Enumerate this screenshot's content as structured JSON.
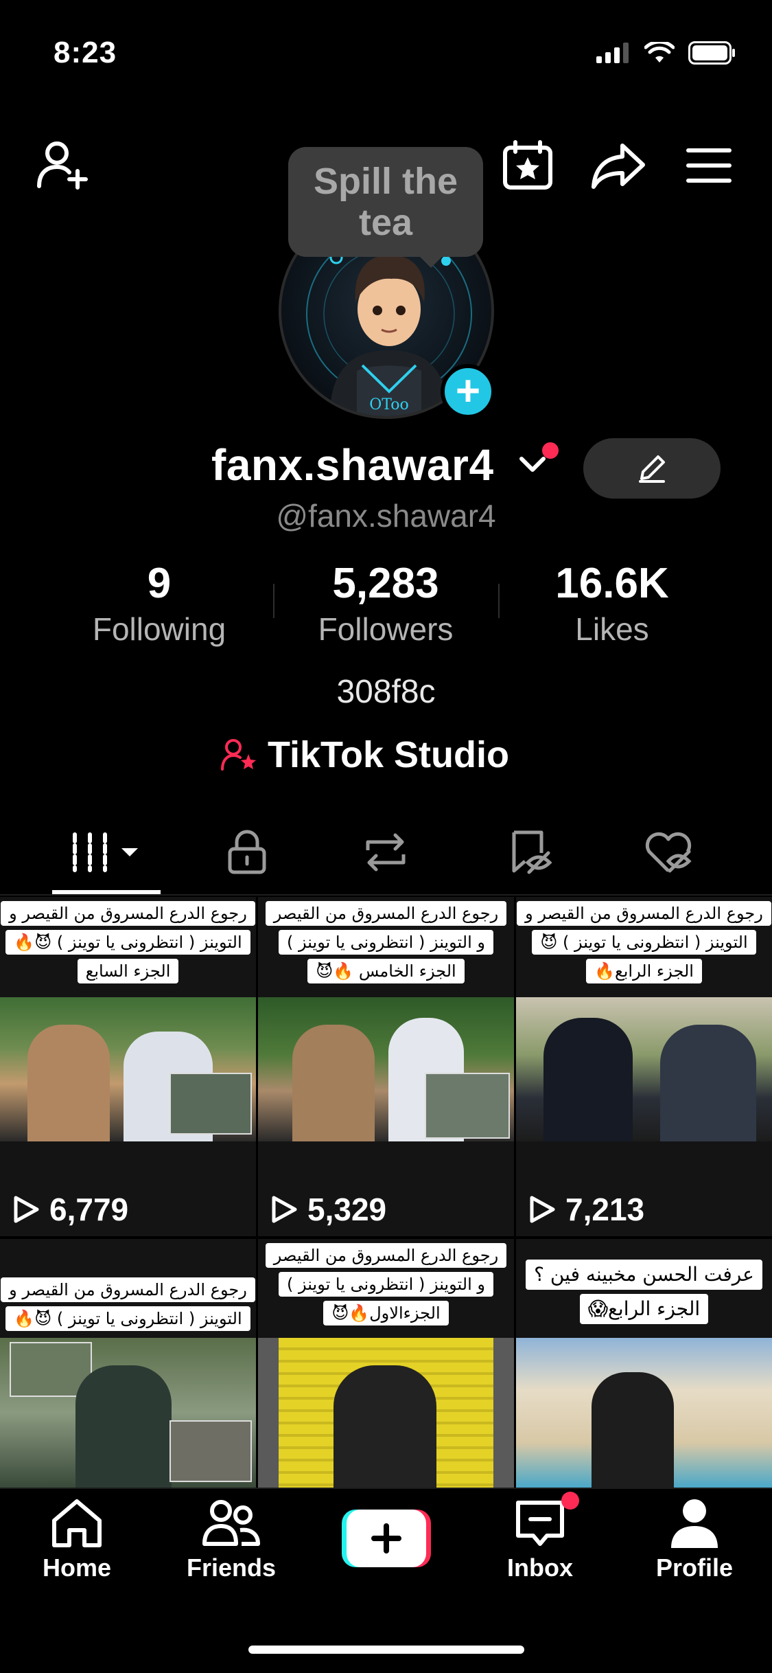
{
  "status_bar": {
    "time": "8:23"
  },
  "tooltip": {
    "text": "Spill the tea"
  },
  "profile": {
    "display_name": "fanx.shawar4",
    "handle": "@fanx.shawar4",
    "bio": "308f8c",
    "studio_label": "TikTok Studio"
  },
  "stats": [
    {
      "value": "9",
      "label": "Following"
    },
    {
      "value": "5,283",
      "label": "Followers"
    },
    {
      "value": "16.6K",
      "label": "Likes"
    }
  ],
  "videos": [
    {
      "caption": [
        "رجوع الدرع المسروق من القيصر و",
        "التوينز ( انتظرونى يا توينز ) 😈🔥",
        "الجزء السابع"
      ],
      "views": "6,779"
    },
    {
      "caption": [
        "رجوع الدرع المسروق من القيصر",
        "و التوينز ( انتظرونى يا توينز )",
        "الجزء الخامس 🔥😈"
      ],
      "views": "5,329"
    },
    {
      "caption": [
        "رجوع الدرع المسروق من القيصر و",
        "التوينز ( انتظرونى يا توينز ) 😈",
        "الجزء الرابع🔥"
      ],
      "views": "7,213"
    },
    {
      "caption": [
        "رجوع الدرع المسروق من القيصر و",
        "التوينز ( انتظرونى يا توينز ) 😈🔥"
      ],
      "views": ""
    },
    {
      "caption": [
        "رجوع الدرع المسروق من القيصر",
        "و التوينز ( انتظرونى يا توينز )",
        "الجزءالاول🔥😈"
      ],
      "views": ""
    },
    {
      "caption": [
        "عرفت الحسن مخبينه فين ؟",
        "الجزء الرابع😱"
      ],
      "views": ""
    }
  ],
  "nav": {
    "home": "Home",
    "friends": "Friends",
    "inbox": "Inbox",
    "profile": "Profile"
  },
  "colors": {
    "accent_cyan": "#21c7e5",
    "accent_red": "#ff2b55",
    "background": "#000000"
  }
}
